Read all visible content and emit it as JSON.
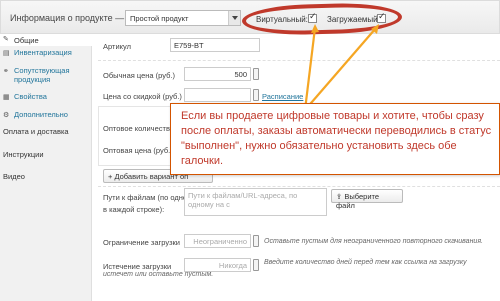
{
  "header": {
    "title": "Информация о продукте —",
    "type_value": "Простой продукт",
    "virtual_label": "Виртуальный:",
    "downloadable_label": "Загружаемый:"
  },
  "sidebar": {
    "items": [
      {
        "label": "Общие",
        "icon": "wrench-icon"
      },
      {
        "label": "Инвентаризация",
        "icon": "stock-icon"
      },
      {
        "label": "Сопутствующая продукция",
        "icon": "link-icon"
      },
      {
        "label": "Свойства",
        "icon": "attributes-icon"
      },
      {
        "label": "Дополнительно",
        "icon": "gear-icon"
      },
      {
        "label": "Оплата и доставка"
      },
      {
        "label": "Инструкции"
      },
      {
        "label": "Видео"
      }
    ]
  },
  "form": {
    "sku_label": "Артикул",
    "sku_value": "E759-BT",
    "regular_price_label": "Обычная цена (руб.)",
    "regular_price_value": "500",
    "sale_price_label": "Цена со скидкой (руб.)",
    "schedule_link": "Расписание",
    "wholesale_qty_label": "Оптовое количество (ш",
    "wholesale_price_label": "Оптовая цена (руб.)",
    "add_variant_button": "+ Добавить вариант оп",
    "file_paths_label": "Пути к файлам (по одному",
    "file_paths_label2": "в каждой строке):",
    "file_paths_placeholder": "Пути к файлам/URL-адреса, по одному на с",
    "choose_file_button": "Выберите файл",
    "download_limit_label": "Ограничение загрузки",
    "download_limit_placeholder": "Неограниченно",
    "download_limit_hint": "Оставьте пустым для неограниченного повторного скачивания.",
    "download_expiry_label": "Истечение загрузки",
    "download_expiry_placeholder": "Никогда",
    "download_expiry_hint": "Введите количество дней перед тем как ссылка на загрузку",
    "download_expiry_hint2": "истечет или оставьте пустым."
  },
  "tooltip": {
    "text": "Если вы продаете цифровые товары и хотите, чтобы сразу после оплаты, заказы автоматически переводились в статус \"выполнен\", нужно обязательно установить здесь обе галочки."
  },
  "colors": {
    "annotation_oval": "#c0392b",
    "arrow": "#f5a623",
    "tooltip_border": "#d35400",
    "tooltip_text": "#c0392b",
    "link": "#21759b"
  }
}
